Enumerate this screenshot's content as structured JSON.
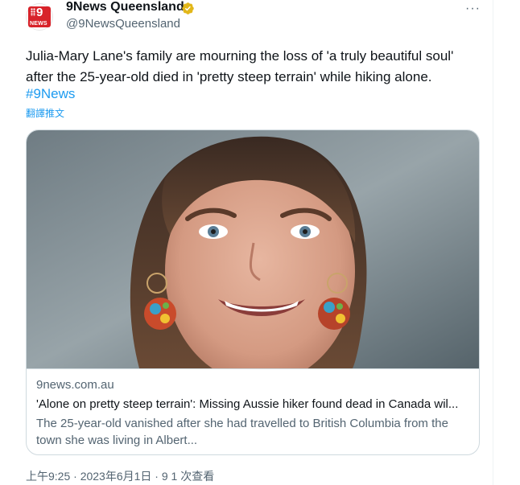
{
  "tweet": {
    "author_name": "9News Queensland",
    "author_handle": "@9NewsQueensland",
    "logo_text": "NEWS",
    "logo_number": "9",
    "text": "Julia-Mary Lane's family are mourning the loss of 'a truly beautiful soul' after the 25-year-old died in 'pretty steep terrain' while hiking alone.",
    "hashtag": "#9News",
    "translate_label": "翻譯推文",
    "timestamp": "上午9:25 · 2023年6月1日",
    "views": "9 1 次查看"
  },
  "card": {
    "domain": "9news.com.au",
    "title": "'Alone on pretty steep terrain': Missing Aussie hiker found dead in Canada wil...",
    "description": "The 25-year-old vanished after she had travelled to British Columbia from the town she was living in Albert..."
  },
  "icons": {
    "verified": "verified-gold-badge-icon",
    "more": "more-options-icon"
  },
  "colors": {
    "link": "#1d9bf0",
    "secondary_text": "#536471",
    "verified_gold": "#e2b719",
    "brand_red": "#d8232a"
  }
}
